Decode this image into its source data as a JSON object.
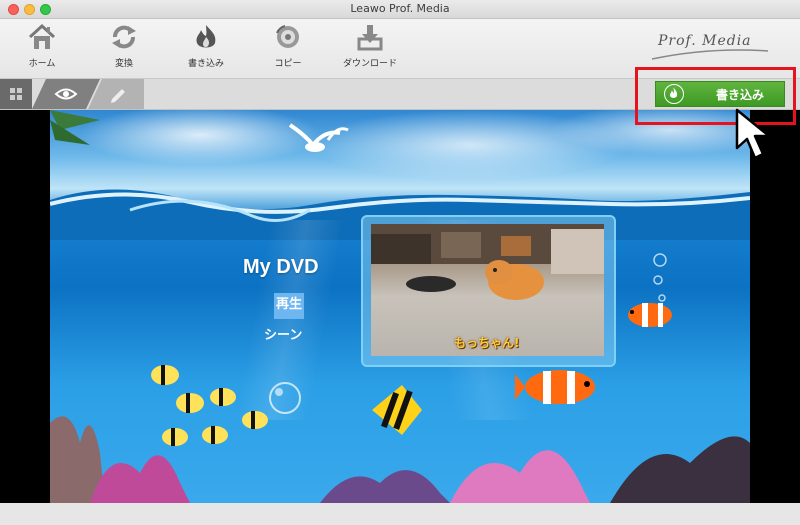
{
  "window": {
    "title": "Leawo Prof. Media"
  },
  "toolbar": {
    "items": [
      {
        "label": "ホーム",
        "icon": "home-icon"
      },
      {
        "label": "変換",
        "icon": "convert-icon"
      },
      {
        "label": "書き込み",
        "icon": "burn-icon"
      },
      {
        "label": "コピー",
        "icon": "copy-icon"
      },
      {
        "label": "ダウンロード",
        "icon": "download-icon"
      }
    ],
    "brand": "Prof. Media"
  },
  "subbar": {
    "burn_button_label": "書き込み",
    "tabs": [
      "grid-icon",
      "eye-icon",
      "pencil-icon"
    ]
  },
  "menu": {
    "title": "My DVD",
    "play_label": "再生",
    "scene_label": "シーン",
    "thumbnail_caption": "もっちゃん!"
  },
  "colors": {
    "burn_button": "#4aa52c",
    "highlight": "#e5131d"
  }
}
